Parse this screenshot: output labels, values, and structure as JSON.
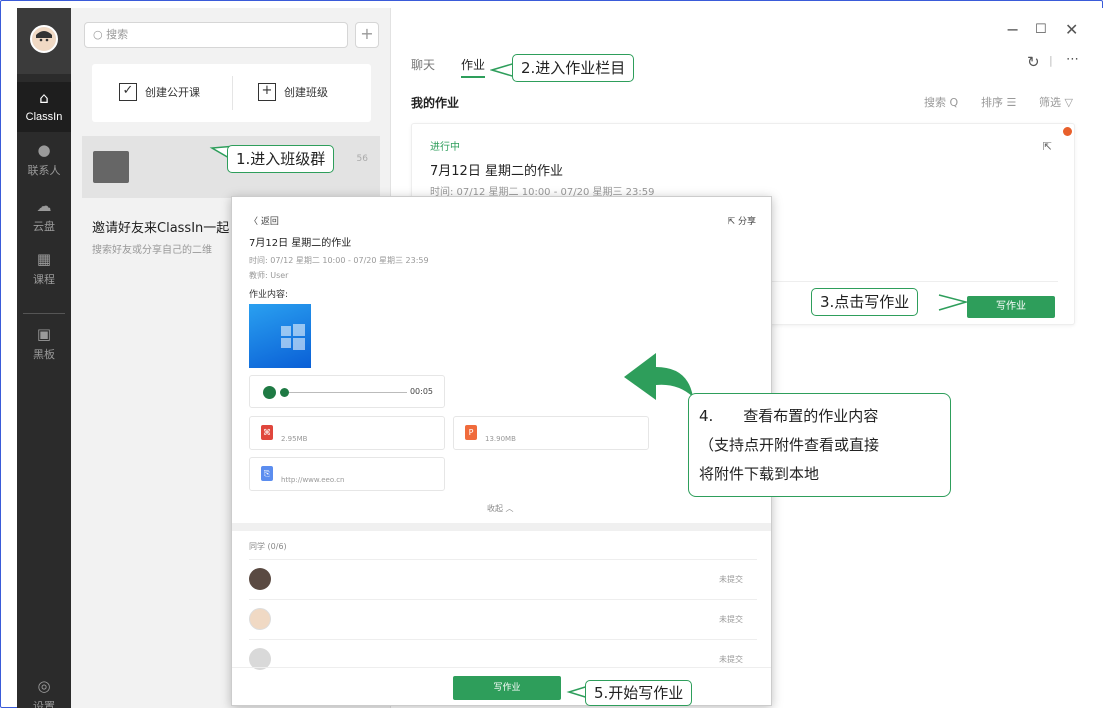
{
  "sidebar": {
    "items": [
      {
        "label": "ClassIn",
        "icon": "home-icon",
        "active": true
      },
      {
        "label": "联系人",
        "icon": "contacts-icon"
      },
      {
        "label": "云盘",
        "icon": "cloud-icon"
      },
      {
        "label": "课程",
        "icon": "calendar-icon"
      },
      {
        "label": "黑板",
        "icon": "blackboard-icon"
      },
      {
        "label": "设置",
        "icon": "settings-icon"
      }
    ]
  },
  "middle": {
    "search_placeholder": "搜索",
    "create_lesson": "创建公开课",
    "create_class": "创建班级",
    "class_time": "56",
    "invite_title": "邀请好友来ClassIn一起",
    "invite_sub": "搜索好友或分享自己的二维"
  },
  "right": {
    "tabs": [
      "聊天",
      "作业"
    ],
    "my_homework": "我的作业",
    "tools": {
      "search": "搜索 Q",
      "sort": "排序 ☰",
      "filter": "筛选 ▽"
    },
    "card": {
      "status": "进行中",
      "title": "7月12日 星期二的作业",
      "time": "时间: 07/12 星期二 10:00 - 07/20 星期三 23:59",
      "write_button": "写作业"
    }
  },
  "dialog": {
    "back": "〈 返回",
    "share": "分享",
    "title": "7月12日 星期二的作业",
    "time": "时间: 07/12 星期二 10:00 - 07/20 星期三 23:59",
    "teacher": "教师: User",
    "content_label": "作业内容:",
    "audio_time": "00:05",
    "files": [
      {
        "size": "2.95MB",
        "type": "pdf",
        "color": "#e0463c"
      },
      {
        "size": "13.90MB",
        "type": "ppt",
        "color": "#f06b3c"
      },
      {
        "size": "http://www.eeo.cn",
        "type": "link",
        "color": "#5b8def"
      }
    ],
    "collapse": "收起 ︿",
    "classmates_title": "同学 (0/6)",
    "classmates": [
      {
        "status": "未提交"
      },
      {
        "status": "未提交"
      },
      {
        "status": "未提交"
      }
    ],
    "write_button": "写作业"
  },
  "callouts": {
    "step1": "1.进入班级群",
    "step2": "2.进入作业栏目",
    "step3": "3.点击写作业",
    "step4_lines": [
      "4.　　查看布置的作业内容",
      "（支持点开附件查看或直接",
      "将附件下载到本地"
    ],
    "step5": "5.开始写作业"
  },
  "colors": {
    "accent": "#2e9e5b",
    "sidebar": "#2b2b2b",
    "badge": "#e8602c"
  }
}
